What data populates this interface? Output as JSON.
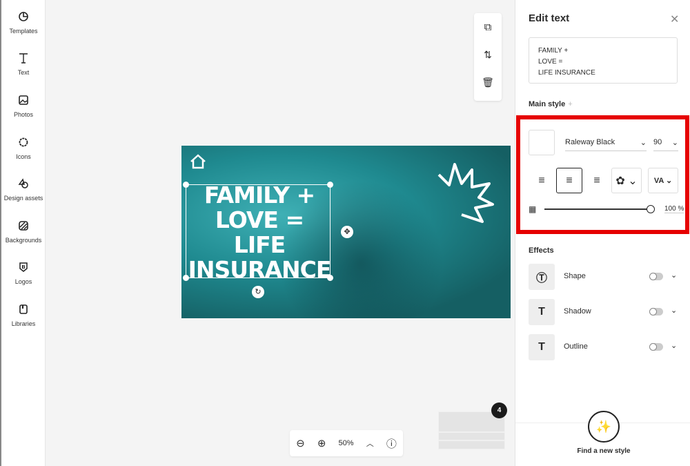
{
  "sidebar": {
    "items": [
      {
        "label": "Templates",
        "icon": "templates-icon"
      },
      {
        "label": "Text",
        "icon": "text-icon"
      },
      {
        "label": "Photos",
        "icon": "photos-icon"
      },
      {
        "label": "Icons",
        "icon": "icons-icon"
      },
      {
        "label": "Design assets",
        "icon": "design-assets-icon"
      },
      {
        "label": "Backgrounds",
        "icon": "backgrounds-icon"
      },
      {
        "label": "Logos",
        "icon": "logos-icon"
      },
      {
        "label": "Libraries",
        "icon": "libraries-icon"
      }
    ]
  },
  "canvas": {
    "headline": "FAMILY +\nLOVE =\nLIFE\nINSURANCE",
    "background_color": "#1f8a90"
  },
  "panel": {
    "title": "Edit text",
    "text_value": "FAMILY +\nLOVE =\nLIFE INSURANCE",
    "main_style": "Main style",
    "plus": "+",
    "font": "Raleway Black",
    "size": "90",
    "opacity": "100 %",
    "opacity_value": 100,
    "highlight_color": "#e60000",
    "effects_title": "Effects",
    "effects": [
      {
        "label": "Shape",
        "glyph": "Ⓣ",
        "on": false
      },
      {
        "label": "Shadow",
        "glyph": "T",
        "on": false
      },
      {
        "label": "Outline",
        "glyph": "T",
        "on": false
      }
    ],
    "find_style": "Find a new style"
  },
  "zoom": {
    "level": "50%"
  },
  "pages": {
    "count": "4"
  }
}
